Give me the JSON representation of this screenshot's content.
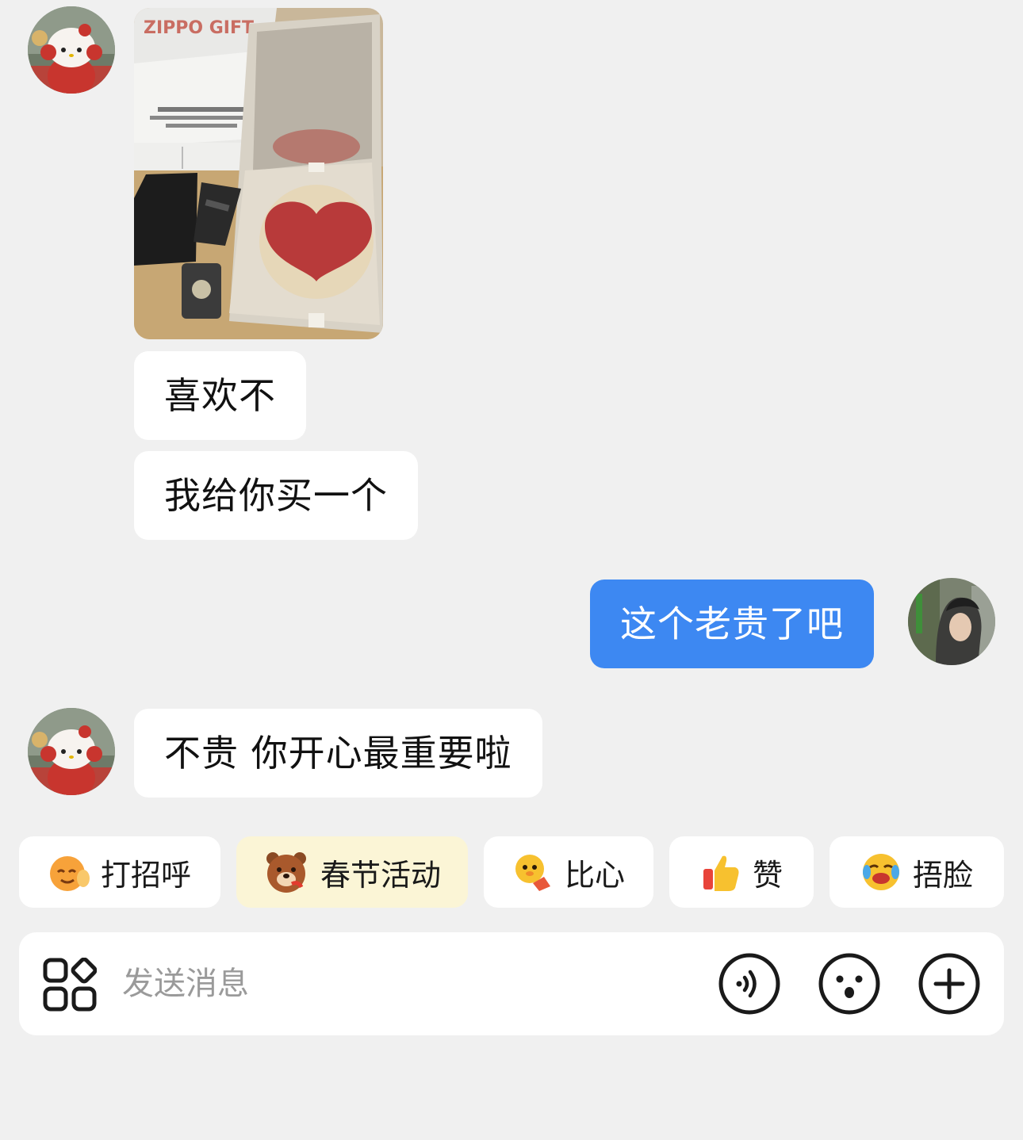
{
  "messages": [
    {
      "from": "contact",
      "type": "image",
      "image_text": "ZIPPO GIFT"
    },
    {
      "from": "contact",
      "type": "text",
      "text": "喜欢不"
    },
    {
      "from": "contact",
      "type": "text",
      "text": "我给你买一个"
    },
    {
      "from": "me",
      "type": "text",
      "text": "这个老贵了吧"
    },
    {
      "from": "contact",
      "type": "text",
      "text": "不贵 你开心最重要啦"
    }
  ],
  "quick_replies": [
    {
      "label": "打招呼",
      "icon": "wave-emoji-icon"
    },
    {
      "label": "春节活动",
      "icon": "bear-emoji-icon",
      "highlighted": true
    },
    {
      "label": "比心",
      "icon": "heart-hand-emoji-icon"
    },
    {
      "label": "赞",
      "icon": "thumbs-up-emoji-icon"
    },
    {
      "label": "捂脸",
      "icon": "facepalm-emoji-icon"
    }
  ],
  "composer": {
    "placeholder": "发送消息",
    "icons": [
      "apps-icon",
      "voice-icon",
      "emoji-icon",
      "plus-icon"
    ]
  },
  "colors": {
    "background": "#f0f0f0",
    "bubble_received": "#ffffff",
    "bubble_sent": "#3d88f2",
    "chip_highlight": "#fbf5d6"
  }
}
